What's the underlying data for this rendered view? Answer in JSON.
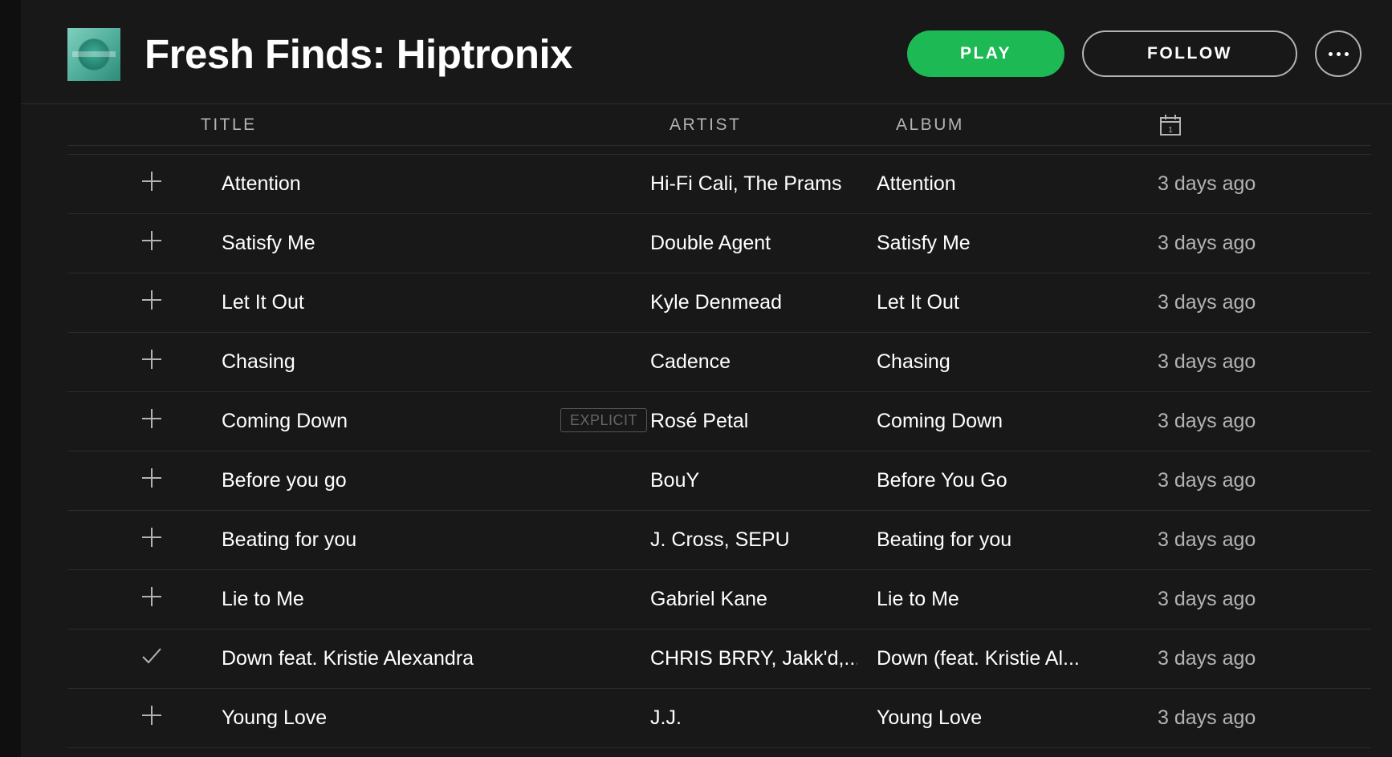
{
  "playlist": {
    "title": "Fresh Finds: Hiptronix",
    "cover_icon": "playlist-cover-art"
  },
  "actions": {
    "play_label": "PLAY",
    "follow_label": "FOLLOW",
    "more_icon": "ellipsis-icon",
    "play_color": "#1db954"
  },
  "columns": {
    "title": "TITLE",
    "artist": "ARTIST",
    "album": "ALBUM",
    "date_icon": "calendar-icon",
    "date_icon_text": "1"
  },
  "tracks": [
    {
      "title": "Attention",
      "artist": "Hi-Fi Cali, The Prams",
      "album": "Attention",
      "added": "3 days ago",
      "saved": false,
      "explicit": ""
    },
    {
      "title": "Satisfy Me",
      "artist": "Double Agent",
      "album": "Satisfy Me",
      "added": "3 days ago",
      "saved": false,
      "explicit": ""
    },
    {
      "title": "Let It Out",
      "artist": "Kyle Denmead",
      "album": "Let It Out",
      "added": "3 days ago",
      "saved": false,
      "explicit": ""
    },
    {
      "title": "Chasing",
      "artist": "Cadence",
      "album": "Chasing",
      "added": "3 days ago",
      "saved": false,
      "explicit": ""
    },
    {
      "title": "Coming Down",
      "artist": "Rosé Petal",
      "album": "Coming Down",
      "added": "3 days ago",
      "saved": false,
      "explicit": "EXPLICIT"
    },
    {
      "title": "Before you go",
      "artist": "BouY",
      "album": "Before You Go",
      "added": "3 days ago",
      "saved": false,
      "explicit": ""
    },
    {
      "title": "Beating for you",
      "artist": "J. Cross, SEPU",
      "album": "Beating for you",
      "added": "3 days ago",
      "saved": false,
      "explicit": ""
    },
    {
      "title": "Lie to Me",
      "artist": "Gabriel Kane",
      "album": "Lie to Me",
      "added": "3 days ago",
      "saved": false,
      "explicit": ""
    },
    {
      "title": "Down feat. Kristie Alexandra",
      "artist": "CHRIS BRRY, Jakk'd,...",
      "album": "Down (feat. Kristie Al...",
      "added": "3 days ago",
      "saved": true,
      "explicit": ""
    },
    {
      "title": "Young Love",
      "artist": "J.J.",
      "album": "Young Love",
      "added": "3 days ago",
      "saved": false,
      "explicit": ""
    }
  ]
}
